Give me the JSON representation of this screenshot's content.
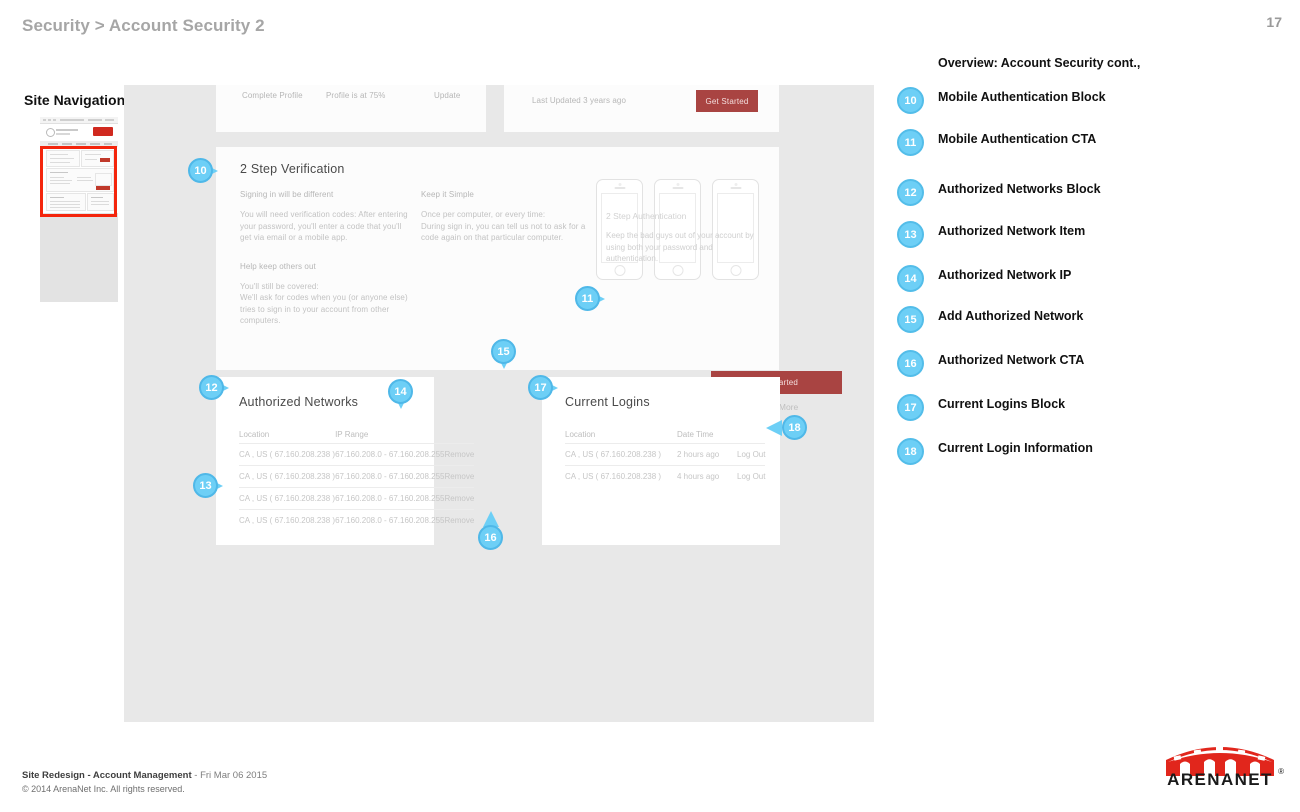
{
  "header": {
    "breadcrumb": "Security > Account Security 2",
    "page_number": "17"
  },
  "sidebar": {
    "title": "Site Navigation"
  },
  "wireframe": {
    "top_left_card": {
      "label": "Complete Profile",
      "status": "Profile is at 75%",
      "action": "Update"
    },
    "top_right_card": {
      "status": "Last Updated 3 years ago",
      "cta": "Get Started"
    },
    "two_step": {
      "title": "2 Step Verification",
      "left_heading": "Signing in will be different",
      "left_body": "You will need verification codes: After entering your password, you'll enter a code that you'll get via email or a mobile app.",
      "left_heading2": "Help keep others out",
      "left_body2": "You'll still be covered:\nWe'll ask for codes when you (or anyone else) tries to sign in to your account from other computers.",
      "right_heading": "Keep it Simple",
      "right_body": "Once per computer, or every time:\nDuring sign in, you can tell us not to ask for a code again on that particular computer.",
      "phone_overlay_title": "2 Step Authentication",
      "phone_overlay_body": "Keep the bad guys out of your account by using both your password and authentication.",
      "cta": "Get Started",
      "learn_more": "Learn More"
    },
    "authorized_networks": {
      "title": "Authorized Networks",
      "columns": [
        "Location",
        "IP Range",
        ""
      ],
      "rows": [
        [
          "CA , US ( 67.160.208.238 )",
          "67.160.208.0 - 67.160.208.255",
          "Remove"
        ],
        [
          "CA , US ( 67.160.208.238 )",
          "67.160.208.0 - 67.160.208.255",
          "Remove"
        ],
        [
          "CA , US ( 67.160.208.238 )",
          "67.160.208.0 - 67.160.208.255",
          "Remove"
        ],
        [
          "CA , US ( 67.160.208.238 )",
          "67.160.208.0 - 67.160.208.255",
          "Remove"
        ]
      ]
    },
    "current_logins": {
      "title": "Current Logins",
      "columns": [
        "Location",
        "Date Time",
        ""
      ],
      "rows": [
        [
          "CA , US ( 67.160.208.238 )",
          "2 hours ago",
          "Log Out"
        ],
        [
          "CA , US ( 67.160.208.238 )",
          "4 hours ago",
          "Log Out"
        ]
      ]
    }
  },
  "callouts": [
    {
      "num": "10",
      "dir": "r"
    },
    {
      "num": "11",
      "dir": "r"
    },
    {
      "num": "12",
      "dir": "r"
    },
    {
      "num": "13",
      "dir": "r"
    },
    {
      "num": "14",
      "dir": "d"
    },
    {
      "num": "15",
      "dir": "d"
    },
    {
      "num": "16",
      "dir": "u"
    },
    {
      "num": "17",
      "dir": "r"
    },
    {
      "num": "18",
      "dir": "l"
    }
  ],
  "legend": {
    "heading": "Overview: Account Security cont.,",
    "items": [
      {
        "num": "10",
        "label": "Mobile Authentication Block"
      },
      {
        "num": "11",
        "label": "Mobile Authentication CTA"
      },
      {
        "num": "12",
        "label": "Authorized Networks Block"
      },
      {
        "num": "13",
        "label": "Authorized Network Item"
      },
      {
        "num": "14",
        "label": "Authorized Network IP"
      },
      {
        "num": "15",
        "label": "Add Authorized Network"
      },
      {
        "num": "16",
        "label": "Authorized Network CTA"
      },
      {
        "num": "17",
        "label": "Current Logins Block"
      },
      {
        "num": "18",
        "label": "Current Login Information"
      }
    ]
  },
  "footer": {
    "project": "Site Redesign - Account Management",
    "separator": " - ",
    "date": "Fri Mar 06 2015",
    "copyright": "© 2014 ArenaNet Inc. All rights reserved.",
    "logo_text": "ARENANET",
    "logo_reg": "®"
  },
  "colors": {
    "callout": "#6dcff6",
    "cta": "#a94442",
    "highlight": "#f4250c",
    "canvas": "#e8e8e8"
  }
}
